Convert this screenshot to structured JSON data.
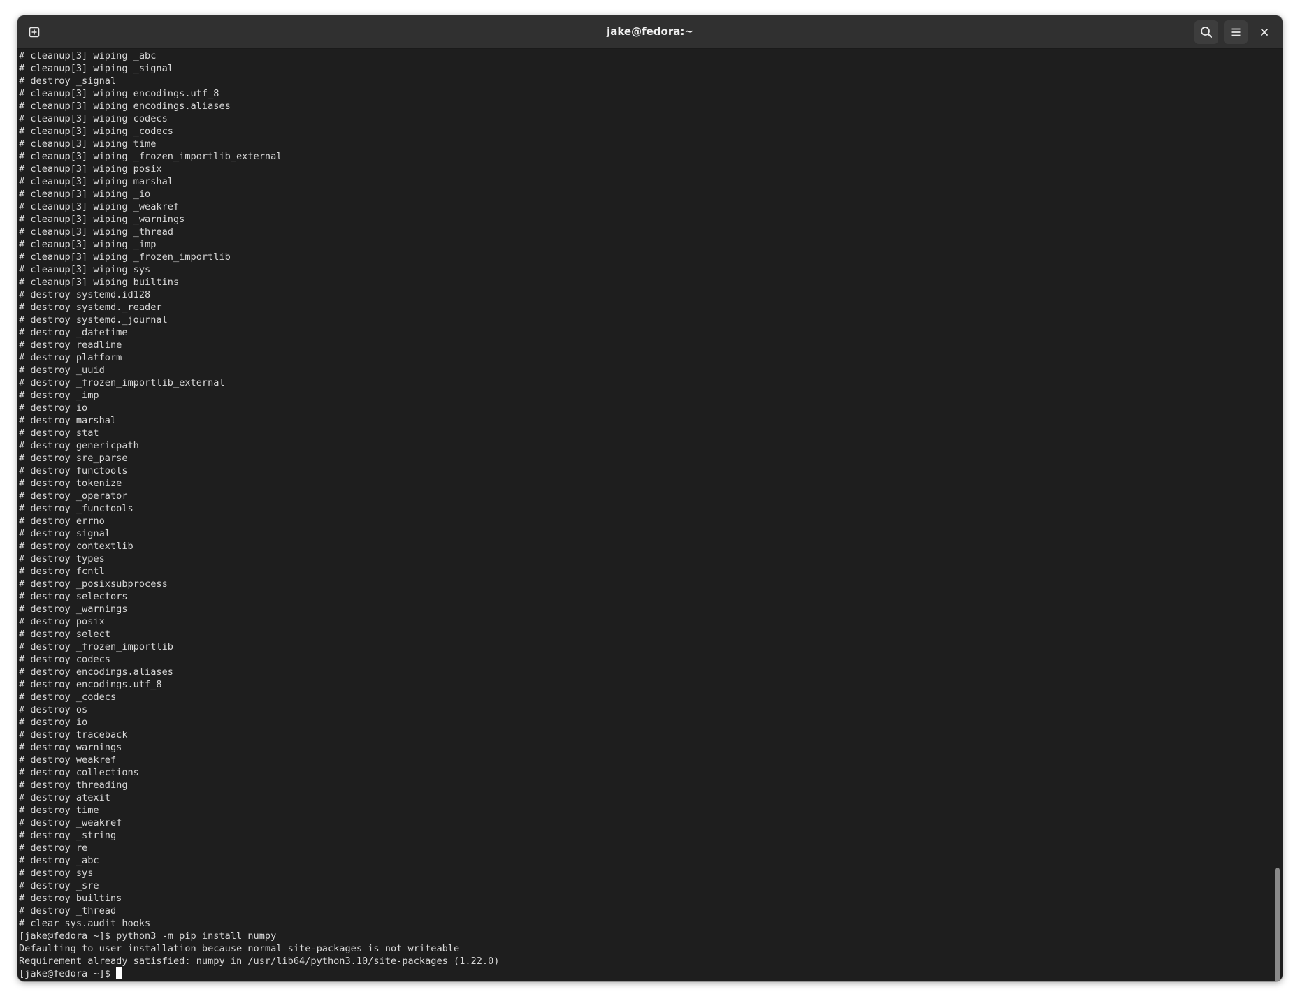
{
  "window": {
    "title": "jake@fedora:~"
  },
  "icons": {
    "new_tab": "new-tab-icon",
    "search": "search-icon",
    "menu": "hamburger-menu-icon",
    "close": "close-icon"
  },
  "terminal": {
    "lines": [
      "# cleanup[3] wiping _abc",
      "# cleanup[3] wiping _signal",
      "# destroy _signal",
      "# cleanup[3] wiping encodings.utf_8",
      "# cleanup[3] wiping encodings.aliases",
      "# cleanup[3] wiping codecs",
      "# cleanup[3] wiping _codecs",
      "# cleanup[3] wiping time",
      "# cleanup[3] wiping _frozen_importlib_external",
      "# cleanup[3] wiping posix",
      "# cleanup[3] wiping marshal",
      "# cleanup[3] wiping _io",
      "# cleanup[3] wiping _weakref",
      "# cleanup[3] wiping _warnings",
      "# cleanup[3] wiping _thread",
      "# cleanup[3] wiping _imp",
      "# cleanup[3] wiping _frozen_importlib",
      "# cleanup[3] wiping sys",
      "# cleanup[3] wiping builtins",
      "# destroy systemd.id128",
      "# destroy systemd._reader",
      "# destroy systemd._journal",
      "# destroy _datetime",
      "# destroy readline",
      "# destroy platform",
      "# destroy _uuid",
      "# destroy _frozen_importlib_external",
      "# destroy _imp",
      "# destroy io",
      "# destroy marshal",
      "# destroy stat",
      "# destroy genericpath",
      "# destroy sre_parse",
      "# destroy functools",
      "# destroy tokenize",
      "# destroy _operator",
      "# destroy _functools",
      "# destroy errno",
      "# destroy signal",
      "# destroy contextlib",
      "# destroy types",
      "# destroy fcntl",
      "# destroy _posixsubprocess",
      "# destroy selectors",
      "# destroy _warnings",
      "# destroy posix",
      "# destroy select",
      "# destroy _frozen_importlib",
      "# destroy codecs",
      "# destroy encodings.aliases",
      "# destroy encodings.utf_8",
      "# destroy _codecs",
      "# destroy os",
      "# destroy io",
      "# destroy traceback",
      "# destroy warnings",
      "# destroy weakref",
      "# destroy collections",
      "# destroy threading",
      "# destroy atexit",
      "# destroy time",
      "# destroy _weakref",
      "# destroy _string",
      "# destroy re",
      "# destroy _abc",
      "# destroy sys",
      "# destroy _sre",
      "# destroy builtins",
      "# destroy _thread",
      "# clear sys.audit hooks",
      "[jake@fedora ~]$ python3 -m pip install numpy",
      "Defaulting to user installation because normal site-packages is not writeable",
      "Requirement already satisfied: numpy in /usr/lib64/python3.10/site-packages (1.22.0)"
    ],
    "prompt": "[jake@fedora ~]$ "
  }
}
